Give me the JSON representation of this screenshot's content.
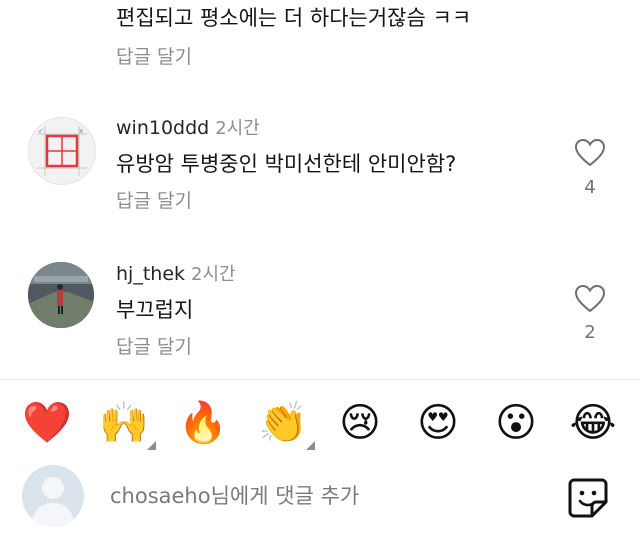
{
  "comments": [
    {
      "text": "편집되고 평소에는 더 하다는거잖슴 ㅋㅋ",
      "reply_label": "답글 달기"
    },
    {
      "username": "win10ddd",
      "time": "2시간",
      "text": "유방암 투병중인 박미선한테 안미안함?",
      "reply_label": "답글 달기",
      "likes": "4",
      "avatar_icon": "window-grid-icon"
    },
    {
      "username": "hj_thek",
      "time": "2시간",
      "text": "부끄럽지",
      "reply_label": "답글 달기",
      "likes": "2",
      "avatar_icon": "photo-avatar"
    }
  ],
  "emoji_bar": [
    {
      "glyph": "❤️",
      "name": "red-heart-emoji",
      "has_variants": false
    },
    {
      "glyph": "🙌",
      "name": "raising-hands-emoji",
      "has_variants": true
    },
    {
      "glyph": "🔥",
      "name": "fire-emoji",
      "has_variants": false
    },
    {
      "glyph": "👏",
      "name": "clapping-hands-emoji",
      "has_variants": true
    },
    {
      "glyph": "😢",
      "name": "crying-face-emoji",
      "has_variants": false
    },
    {
      "glyph": "😍",
      "name": "heart-eyes-emoji",
      "has_variants": false
    },
    {
      "glyph": "😮",
      "name": "surprised-face-emoji",
      "has_variants": false
    },
    {
      "glyph": "😂",
      "name": "tears-of-joy-emoji",
      "has_variants": false
    }
  ],
  "composer": {
    "placeholder": "chosaeho님에게 댓글 추가",
    "sticker_icon": "sticker-icon"
  },
  "colors": {
    "secondary_text": "#8e8e8e",
    "divider": "#e6e6e6"
  }
}
